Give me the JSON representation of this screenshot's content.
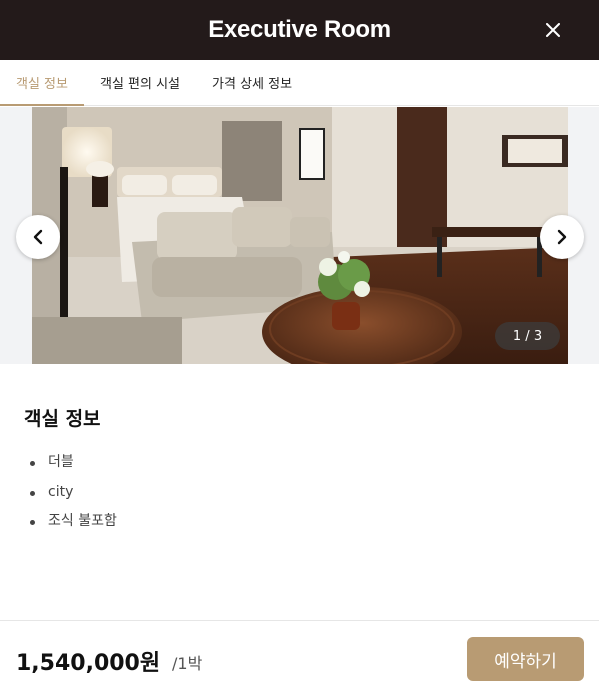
{
  "header": {
    "title": "Executive Room",
    "close_icon": "close-icon"
  },
  "tabs": [
    {
      "label": "객실 정보",
      "active": true
    },
    {
      "label": "객실 편의 시설",
      "active": false
    },
    {
      "label": "가격 상세 정보",
      "active": false
    }
  ],
  "gallery": {
    "counter": "1 / 3",
    "prev_icon": "chevron-left-icon",
    "next_icon": "chevron-right-icon",
    "photo": "hotel-room-photo"
  },
  "room_info": {
    "title": "객실 정보",
    "items": [
      "더블",
      "city",
      "조식 불포함"
    ]
  },
  "footer": {
    "price": "1,540,000원",
    "per": "/1박",
    "book_label": "예약하기"
  },
  "colors": {
    "header_bg": "#231a1a",
    "accent": "#b89b73"
  }
}
